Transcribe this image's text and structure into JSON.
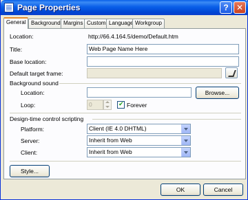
{
  "window": {
    "title": "Page Properties",
    "help_glyph": "?",
    "close_glyph": "✕"
  },
  "tabs": [
    {
      "label": "General",
      "active": true
    },
    {
      "label": "Background",
      "active": false
    },
    {
      "label": "Margins",
      "active": false
    },
    {
      "label": "Custom",
      "active": false
    },
    {
      "label": "Language",
      "active": false
    },
    {
      "label": "Workgroup",
      "active": false
    }
  ],
  "general": {
    "location_label": "Location:",
    "location_value": "http://66.4.164.5/demo/Default.htm",
    "title_label": "Title:",
    "title_value": "Web Page Name Here",
    "base_location_label": "Base location:",
    "base_location_value": "",
    "default_target_label": "Default target frame:",
    "default_target_value": ""
  },
  "background_sound": {
    "section_label": "Background sound",
    "location_label": "Location:",
    "location_value": "",
    "browse_label": "Browse...",
    "loop_label": "Loop:",
    "loop_value": "0",
    "forever_label": "Forever",
    "forever_checked": true
  },
  "scripting": {
    "section_label": "Design-time control scripting",
    "platform_label": "Platform:",
    "platform_value": "Client (IE 4.0 DHTML)",
    "server_label": "Server:",
    "server_value": "Inherit from Web",
    "client_label": "Client:",
    "client_value": "Inherit from Web"
  },
  "buttons": {
    "style": "Style...",
    "ok": "OK",
    "cancel": "Cancel"
  }
}
